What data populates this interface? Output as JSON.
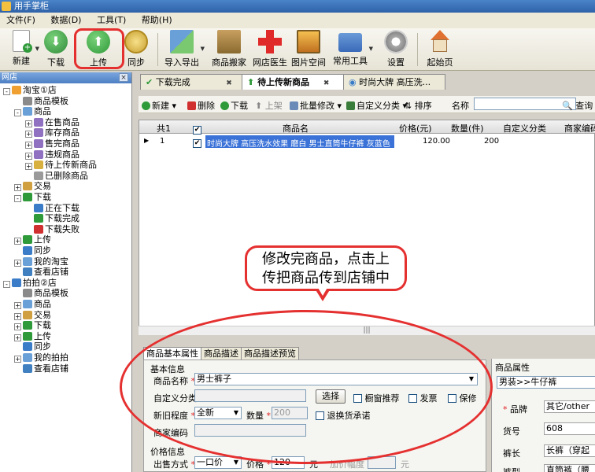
{
  "window": {
    "title": "用手掌柜"
  },
  "menu": [
    "文件(F)",
    "数据(D)",
    "工具(T)",
    "帮助(H)"
  ],
  "toolbar": {
    "new": "新建",
    "download": "下载",
    "upload": "上传",
    "sync": "同步",
    "import_export": "导入导出",
    "move": "商品搬家",
    "doctor": "网店医生",
    "images": "图片空间",
    "tools": "常用工具",
    "settings": "设置",
    "home": "起始页"
  },
  "sidebar": {
    "header": "网店",
    "close": "×",
    "tree": [
      {
        "label": "淘宝①店",
        "level": 0,
        "toggle": "-",
        "icon": "#f0a030"
      },
      {
        "label": "商品模板",
        "level": 1,
        "toggle": "",
        "icon": "#8a8a8a"
      },
      {
        "label": "商品",
        "level": 1,
        "toggle": "-",
        "icon": "#6aa0d8"
      },
      {
        "label": "在售商品",
        "level": 2,
        "toggle": "+",
        "icon": "#9070c0"
      },
      {
        "label": "库存商品",
        "level": 2,
        "toggle": "+",
        "icon": "#9070c0"
      },
      {
        "label": "售完商品",
        "level": 2,
        "toggle": "+",
        "icon": "#9070c0"
      },
      {
        "label": "违规商品",
        "level": 2,
        "toggle": "+",
        "icon": "#9070c0"
      },
      {
        "label": "待上传新商品",
        "level": 2,
        "toggle": "+",
        "icon": "#d8b040"
      },
      {
        "label": "已删除商品",
        "level": 2,
        "toggle": "",
        "icon": "#9a9a9a"
      },
      {
        "label": "交易",
        "level": 1,
        "toggle": "+",
        "icon": "#d0a040"
      },
      {
        "label": "下载",
        "level": 1,
        "toggle": "-",
        "icon": "#2f9a3a"
      },
      {
        "label": "正在下载",
        "level": 2,
        "toggle": "",
        "icon": "#3a7cc8"
      },
      {
        "label": "下载完成",
        "level": 2,
        "toggle": "",
        "icon": "#2f9a3a"
      },
      {
        "label": "下载失败",
        "level": 2,
        "toggle": "",
        "icon": "#d03030"
      },
      {
        "label": "上传",
        "level": 1,
        "toggle": "+",
        "icon": "#2f9a3a"
      },
      {
        "label": "同步",
        "level": 1,
        "toggle": "",
        "icon": "#3a7cc8"
      },
      {
        "label": "我的淘宝",
        "level": 1,
        "toggle": "+",
        "icon": "#6aa0d8"
      },
      {
        "label": "查看店铺",
        "level": 1,
        "toggle": "",
        "icon": "#4080c0"
      },
      {
        "label": "拍拍②店",
        "level": 0,
        "toggle": "-",
        "icon": "#3a7cc8"
      },
      {
        "label": "商品模板",
        "level": 1,
        "toggle": "",
        "icon": "#8a8a8a"
      },
      {
        "label": "商品",
        "level": 1,
        "toggle": "+",
        "icon": "#6aa0d8"
      },
      {
        "label": "交易",
        "level": 1,
        "toggle": "+",
        "icon": "#d0a040"
      },
      {
        "label": "下载",
        "level": 1,
        "toggle": "+",
        "icon": "#2f9a3a"
      },
      {
        "label": "上传",
        "level": 1,
        "toggle": "+",
        "icon": "#2f9a3a"
      },
      {
        "label": "同步",
        "level": 1,
        "toggle": "",
        "icon": "#3a7cc8"
      },
      {
        "label": "我的拍拍",
        "level": 1,
        "toggle": "+",
        "icon": "#6aa0d8"
      },
      {
        "label": "查看店铺",
        "level": 1,
        "toggle": "",
        "icon": "#4080c0"
      }
    ]
  },
  "tabs": [
    "下载完成",
    "待上传新商品",
    "时尚大牌 高压洗..."
  ],
  "grid_toolbar": {
    "new": "新建",
    "delete": "删除",
    "download": "下载",
    "list": "上架",
    "batch_edit": "批量修改",
    "custom_category": "自定义分类",
    "sort": "排序",
    "name_label": "名称",
    "search": "查询"
  },
  "grid": {
    "count": "共1",
    "columns": [
      "商品名",
      "价格(元)",
      "数量(件)",
      "自定义分类",
      "商家编码"
    ],
    "rows": [
      {
        "index": "1",
        "name": "时尚大牌 高压洗水效果 磨白 男士直筒牛仔裤 灰蓝色",
        "price": "120.00",
        "qty": "200",
        "category": "",
        "code": ""
      }
    ],
    "scroll_grip": "|||"
  },
  "callout": {
    "line1": "修改完商品，点击上",
    "line2": "传把商品传到店铺中"
  },
  "panel": {
    "tabs": [
      "商品基本属性",
      "商品描述",
      "商品描述预览"
    ],
    "section_basic": "基本信息",
    "product_name_label": "商品名称",
    "product_name_value": "男士裤子",
    "custom_category_label": "自定义分类",
    "choose_button": "选择",
    "window_recommend": "橱窗推荐",
    "invoice": "发票",
    "warranty": "保修",
    "condition_label": "新旧程度",
    "condition_value": "全新",
    "quantity_label": "数量",
    "quantity_value": "200",
    "return_label": "退换货承诺",
    "merchant_code_label": "商家编码",
    "section_price": "价格信息",
    "sale_method_label": "出售方式",
    "sale_method_value": "一口价",
    "price_label": "价格",
    "price_value": "120",
    "price_unit": "元",
    "markup_label": "加价幅度",
    "markup_unit": "元"
  },
  "props": {
    "header": "商品属性",
    "category_path": "男装>>牛仔裤",
    "rows": [
      {
        "label": "品牌",
        "value": "其它/other"
      },
      {
        "label": "货号",
        "value": "608"
      },
      {
        "label": "裤长",
        "value": "长裤（穿起"
      },
      {
        "label": "裤型",
        "value": "直筒裤（腰"
      }
    ]
  },
  "colors": {
    "accent_red": "#e53030",
    "selection": "#3a72d8",
    "upload_green": "#2f9a3a"
  }
}
